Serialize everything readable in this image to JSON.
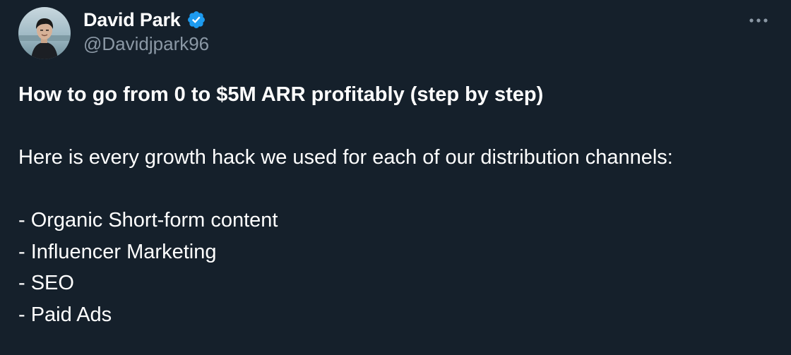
{
  "author": {
    "display_name": "David Park",
    "handle": "@Davidjpark96",
    "verified": true,
    "avatar_icon": "profile-photo"
  },
  "menu": {
    "icon": "more-horizontal-icon"
  },
  "tweet": {
    "headline": "How to go from 0 to $5M ARR profitably (step by step)",
    "intro": "Here is every growth hack we used for each of our distribution channels:",
    "channels": [
      "- Organic Short-form content",
      "- Influencer Marketing",
      "- SEO",
      "- Paid Ads"
    ]
  },
  "colors": {
    "background": "#15202b",
    "text_primary": "#ffffff",
    "text_secondary": "#8b98a5",
    "verified_blue": "#1d9bf0"
  }
}
